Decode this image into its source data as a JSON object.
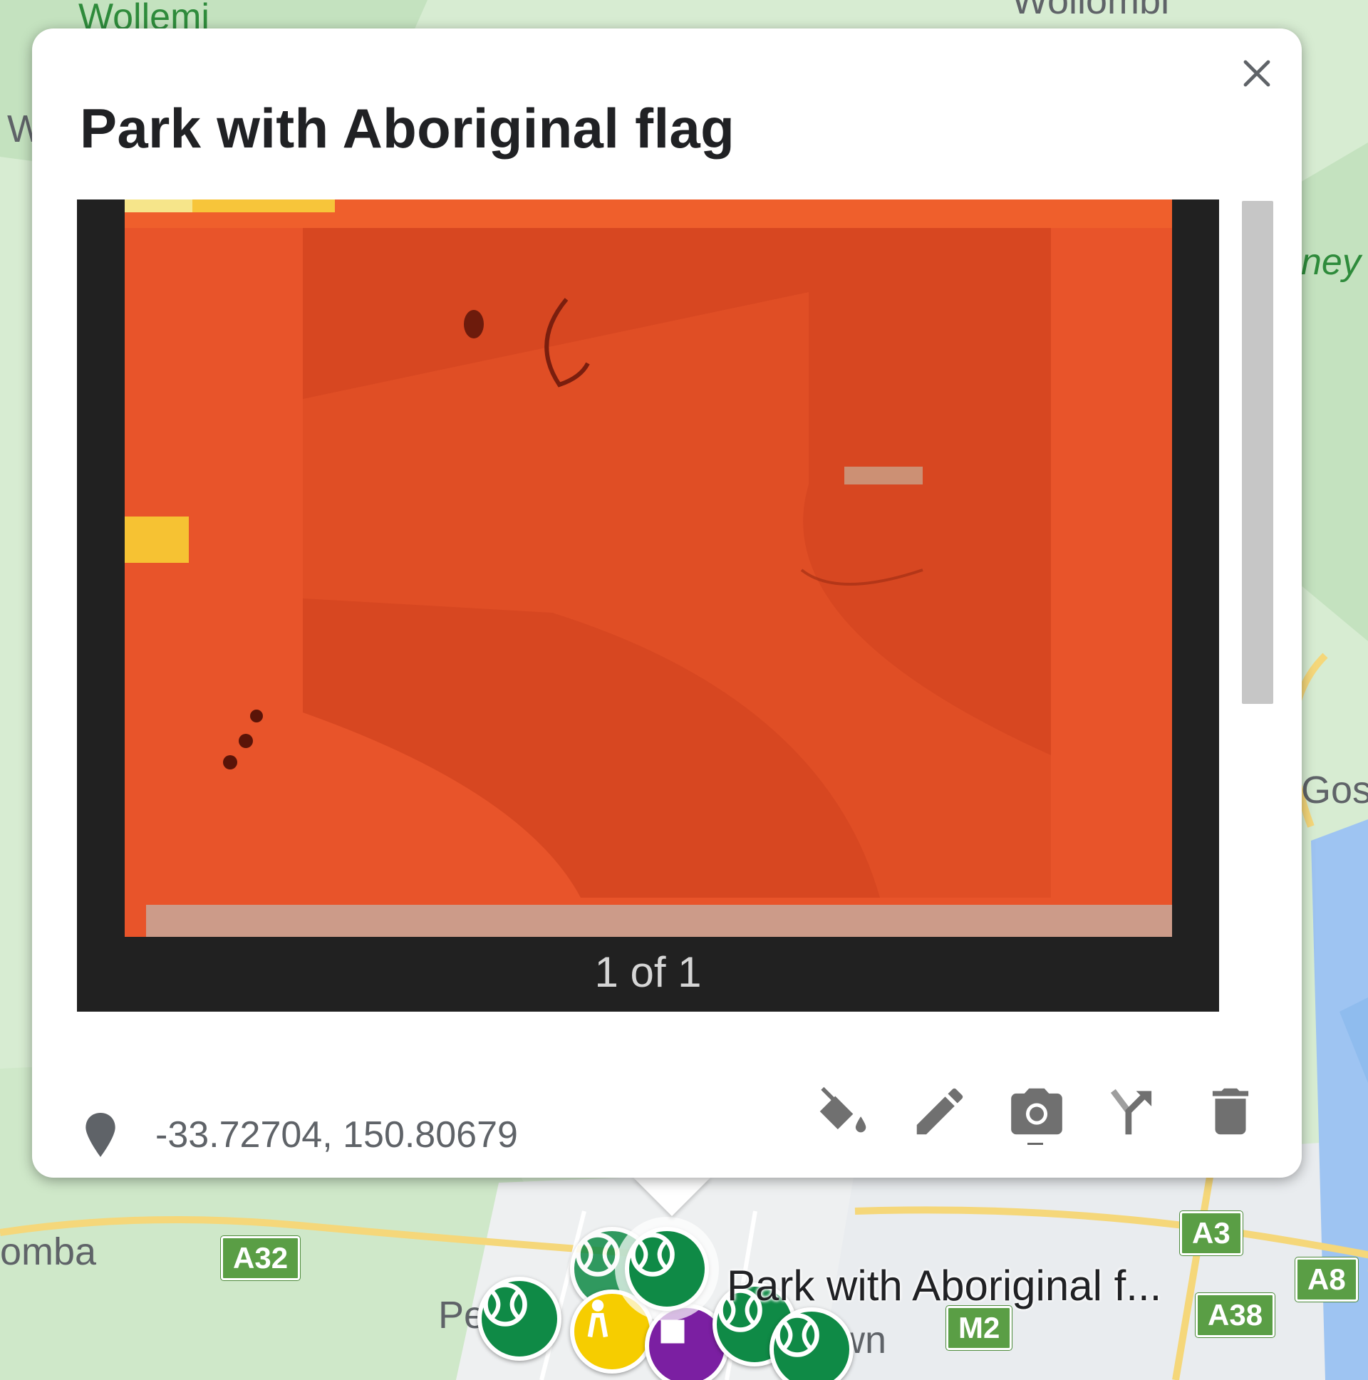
{
  "map": {
    "place_labels": {
      "wollemi": "Wollemi",
      "wollombi": "Wollombi",
      "sydney_partial": "ney",
      "gosford_partial": "Gos",
      "katoomba_partial": "omba",
      "penrith_partial": "Pe",
      "town_partial": "wn",
      "w_partial": "W"
    },
    "road_shields": {
      "a32": "A32",
      "a3": "A3",
      "a8": "A8",
      "a38": "A38",
      "m2": "M2"
    },
    "marker_label": "Park with Aboriginal f..."
  },
  "infowindow": {
    "title": "Park with Aboriginal flag",
    "close_icon": "close-icon",
    "photo_counter": "1 of 1",
    "coordinates": "-33.72704, 150.80679",
    "toolbar": {
      "style_icon": "paint-bucket-icon",
      "edit_icon": "pencil-icon",
      "photo_icon": "camera-icon",
      "directions_icon": "directions-icon",
      "delete_icon": "trash-icon"
    }
  },
  "colors": {
    "marker_green": "#0f8a46",
    "marker_yellow": "#f6cd00",
    "marker_purple": "#7b1fa2",
    "photo_orange": "#e8542a",
    "viewer_bg": "#212121"
  }
}
